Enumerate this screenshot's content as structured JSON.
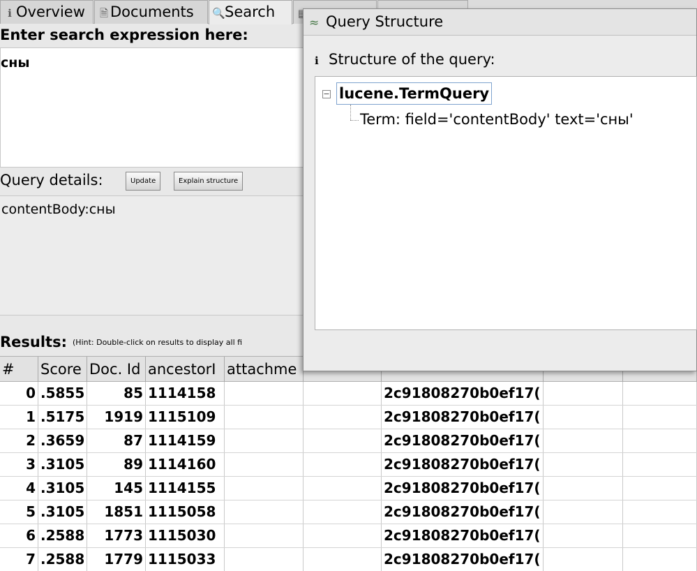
{
  "tabs": [
    {
      "label": "Overview",
      "icon": "info-icon"
    },
    {
      "label": "Documents",
      "icon": "document-icon"
    },
    {
      "label": "Search",
      "icon": "search-icon"
    },
    {
      "label": "",
      "icon": "files-icon"
    },
    {
      "label": "",
      "icon": "plugin-icon"
    }
  ],
  "search": {
    "label": "Enter search expression here:",
    "value": "сны"
  },
  "query_details": {
    "label": "Query details:",
    "update_label": "Update",
    "explain_label": "Explain structure",
    "value": "contentBody:сны"
  },
  "results": {
    "label": "Results:",
    "hint": "(Hint: Double-click on results to display all fi",
    "columns": [
      "#",
      "Score",
      "Doc. Id",
      "ancestorI",
      "attachme",
      "",
      "",
      "",
      ""
    ],
    "rows": [
      [
        "0",
        ".5855",
        "85",
        "1114158",
        "",
        "",
        "2c91808270b0ef17(",
        "",
        ""
      ],
      [
        "1",
        ".5175",
        "1919",
        "1115109",
        "",
        "",
        "2c91808270b0ef17(",
        "",
        ""
      ],
      [
        "2",
        ".3659",
        "87",
        "1114159",
        "",
        "",
        "2c91808270b0ef17(",
        "",
        ""
      ],
      [
        "3",
        ".3105",
        "89",
        "1114160",
        "",
        "",
        "2c91808270b0ef17(",
        "",
        ""
      ],
      [
        "4",
        ".3105",
        "145",
        "1114155",
        "",
        "",
        "2c91808270b0ef17(",
        "",
        ""
      ],
      [
        "5",
        ".3105",
        "1851",
        "1115058",
        "",
        "",
        "2c91808270b0ef17(",
        "",
        ""
      ],
      [
        "6",
        ".2588",
        "1773",
        "1115030",
        "",
        "",
        "2c91808270b0ef17(",
        "",
        ""
      ],
      [
        "7",
        ".2588",
        "1779",
        "1115033",
        "",
        "",
        "2c91808270b0ef17(",
        "",
        ""
      ]
    ]
  },
  "popup": {
    "title": "Query Structure",
    "subtitle": "Structure of the query:",
    "tree_root": "lucene.TermQuery",
    "tree_child": "Term: field='contentBody' text='сны'"
  }
}
